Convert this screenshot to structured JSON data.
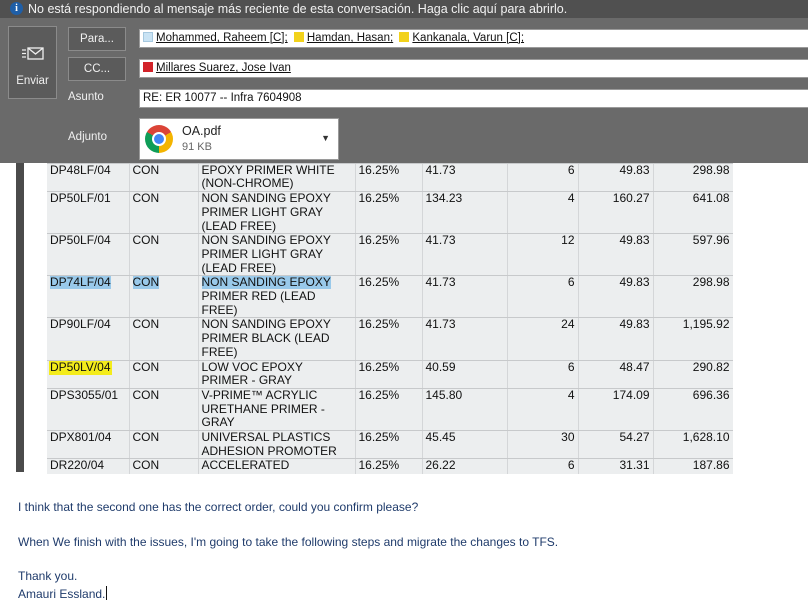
{
  "infobar": {
    "text": "No está respondiendo al mensaje más reciente de esta conversación. Haga clic aquí para abrirlo."
  },
  "compose": {
    "send_label": "Enviar",
    "to_button": "Para...",
    "cc_button": "CC...",
    "subject_label": "Asunto",
    "attach_label": "Adjunto",
    "to": [
      {
        "name": "Mohammed, Raheem [C];",
        "color": "#c9e3f4"
      },
      {
        "name": "Hamdan, Hasan;",
        "color": "#f2d21b"
      },
      {
        "name": "Kankanala, Varun [C];",
        "color": "#f2d21b"
      }
    ],
    "cc": [
      {
        "name": "Millares Suarez, Jose Ivan",
        "color": "#d2232a"
      }
    ],
    "subject": "RE: ER 10077 -- Infra 7604908",
    "attachment": {
      "name": "OA.pdf",
      "size": "91 KB",
      "icon": "chrome-icon"
    }
  },
  "table": {
    "rows": [
      [
        "",
        "",
        "(NON-CHROME)",
        "",
        "",
        "",
        "",
        ""
      ],
      [
        "DP48LF/04",
        "CON",
        "EPOXY PRIMER WHITE (NON-CHROME)",
        "16.25%",
        "41.73",
        "6",
        "49.83",
        "298.98"
      ],
      [
        "DP50LF/01",
        "CON",
        "NON SANDING EPOXY PRIMER LIGHT GRAY (LEAD FREE)",
        "16.25%",
        "134.23",
        "4",
        "160.27",
        "641.08"
      ],
      [
        "DP50LF/04",
        "CON",
        "NON SANDING EPOXY PRIMER LIGHT GRAY (LEAD FREE)",
        "16.25%",
        "41.73",
        "12",
        "49.83",
        "597.96"
      ],
      [
        "DP74LF/04",
        "CON",
        "NON SANDING EPOXY PRIMER RED (LEAD FREE)",
        "16.25%",
        "41.73",
        "6",
        "49.83",
        "298.98"
      ],
      [
        "DP90LF/04",
        "CON",
        "NON SANDING EPOXY PRIMER BLACK (LEAD FREE)",
        "16.25%",
        "41.73",
        "24",
        "49.83",
        "1,195.92"
      ],
      [
        "DP50LV/04",
        "CON",
        "LOW VOC EPOXY PRIMER - GRAY",
        "16.25%",
        "40.59",
        "6",
        "48.47",
        "290.82"
      ],
      [
        "DPS3055/01",
        "CON",
        "V-PRIME™ ACRYLIC URETHANE PRIMER - GRAY",
        "16.25%",
        "145.80",
        "4",
        "174.09",
        "696.36"
      ],
      [
        "DPX801/04",
        "CON",
        "UNIVERSAL PLASTICS ADHESION PROMOTER",
        "16.25%",
        "45.45",
        "30",
        "54.27",
        "1,628.10"
      ],
      [
        "DR220/04",
        "CON",
        "ACCELERATED REDUCER",
        "16.25%",
        "26.22",
        "6",
        "31.31",
        "187.86"
      ]
    ],
    "selected": {
      "code": "DP74LF/04",
      "type": "CON",
      "desc_part": "NON SANDING EPOXY"
    },
    "highlighted": "DP50LV/04",
    "selection_color": "#99c9ea",
    "highlight_color": "#f4ec1b"
  },
  "message": {
    "line1": "I think that the second one has the correct order, could you confirm please?",
    "line2": "When We finish with the issues, I'm going to take the following steps and migrate the changes to TFS.",
    "line3": "Thank you.",
    "line4": "Amauri Essland."
  }
}
